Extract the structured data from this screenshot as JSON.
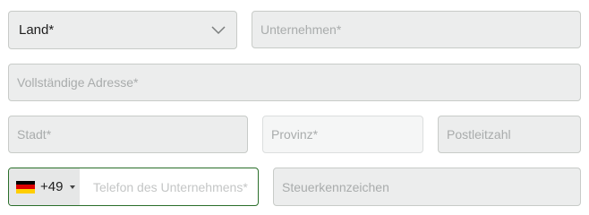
{
  "form": {
    "country": {
      "label": "Land*",
      "icon": "chevron-down-icon"
    },
    "company": {
      "placeholder": "Unternehmen*"
    },
    "address": {
      "placeholder": "Vollständige Adresse*"
    },
    "city": {
      "placeholder": "Stadt*"
    },
    "province": {
      "placeholder": "Provinz*"
    },
    "postal_code": {
      "placeholder": "Postleitzahl"
    },
    "phone": {
      "country_code": "+49",
      "flag_icon": "germany-flag-icon",
      "placeholder": "Telefon des Unternehmens*",
      "active_border_color": "#2a6f2a"
    },
    "tax_id": {
      "placeholder": "Steuerkennzeichen"
    }
  },
  "colors": {
    "field_background": "#eceded",
    "field_border": "#c8cbc8",
    "placeholder_text": "#a9acac",
    "flag_black": "#000000",
    "flag_red": "#dd0000",
    "flag_gold": "#ffce00"
  }
}
